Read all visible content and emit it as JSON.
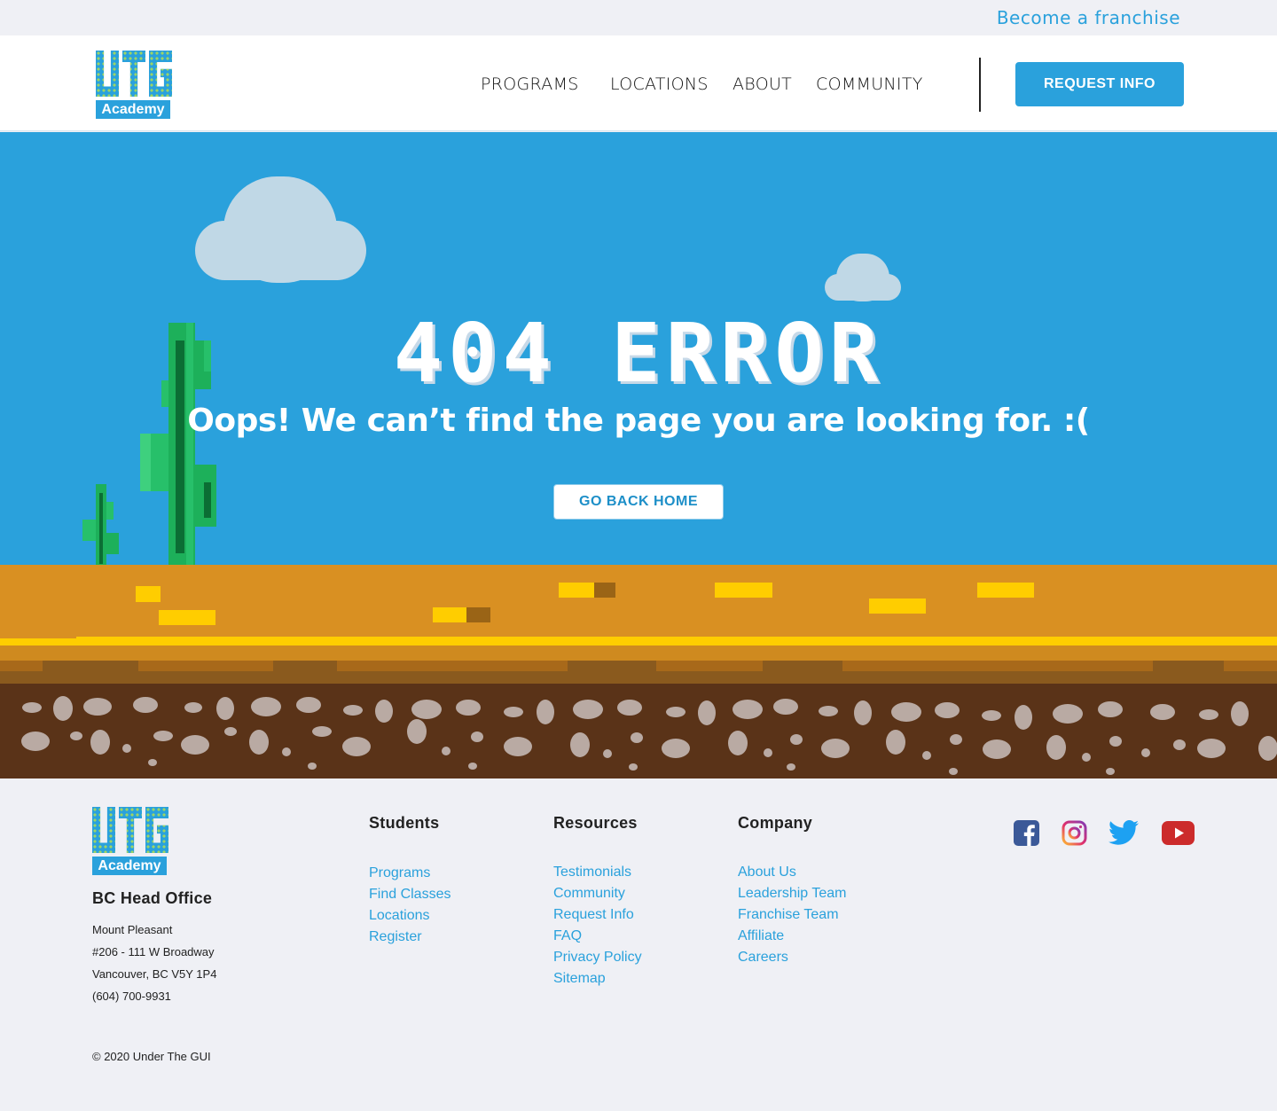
{
  "topbar": {
    "franchise_link": "Become a franchise"
  },
  "header": {
    "logo_word": "Academy",
    "nav": [
      "PROGRAMS",
      "LOCATIONS",
      "ABOUT",
      "COMMUNITY"
    ],
    "cta": "REQUEST INFO"
  },
  "hero": {
    "title": "404 ERROR",
    "message": "Oops! We can’t find the page you are looking for. :(",
    "button": "GO BACK HOME"
  },
  "footer": {
    "logo_word": "Academy",
    "office_title": "BC Head Office",
    "address": [
      "Mount Pleasant",
      "#206 - 111 W Broadway",
      "Vancouver, BC V5Y 1P4",
      "(604) 700-9931"
    ],
    "columns": [
      {
        "title": "Students",
        "links": [
          "Programs",
          "Find Classes",
          "Locations",
          "Register"
        ]
      },
      {
        "title": "Resources",
        "links": [
          "Testimonials",
          "Community",
          "Request Info",
          "FAQ",
          "Privacy Policy",
          "Sitemap"
        ]
      },
      {
        "title": "Company",
        "links": [
          "About Us",
          "Leadership Team",
          "Franchise Team",
          "Affiliate",
          "Careers"
        ]
      }
    ],
    "social": [
      "facebook-icon",
      "instagram-icon",
      "twitter-icon",
      "youtube-icon"
    ],
    "copyright": "© 2020 Under The GUI"
  },
  "colors": {
    "brand_blue": "#2aa1dc",
    "sky": "#2aa1dc",
    "sand": "#d99022",
    "soil": "#5a3318",
    "cactus": "#16a04f"
  }
}
